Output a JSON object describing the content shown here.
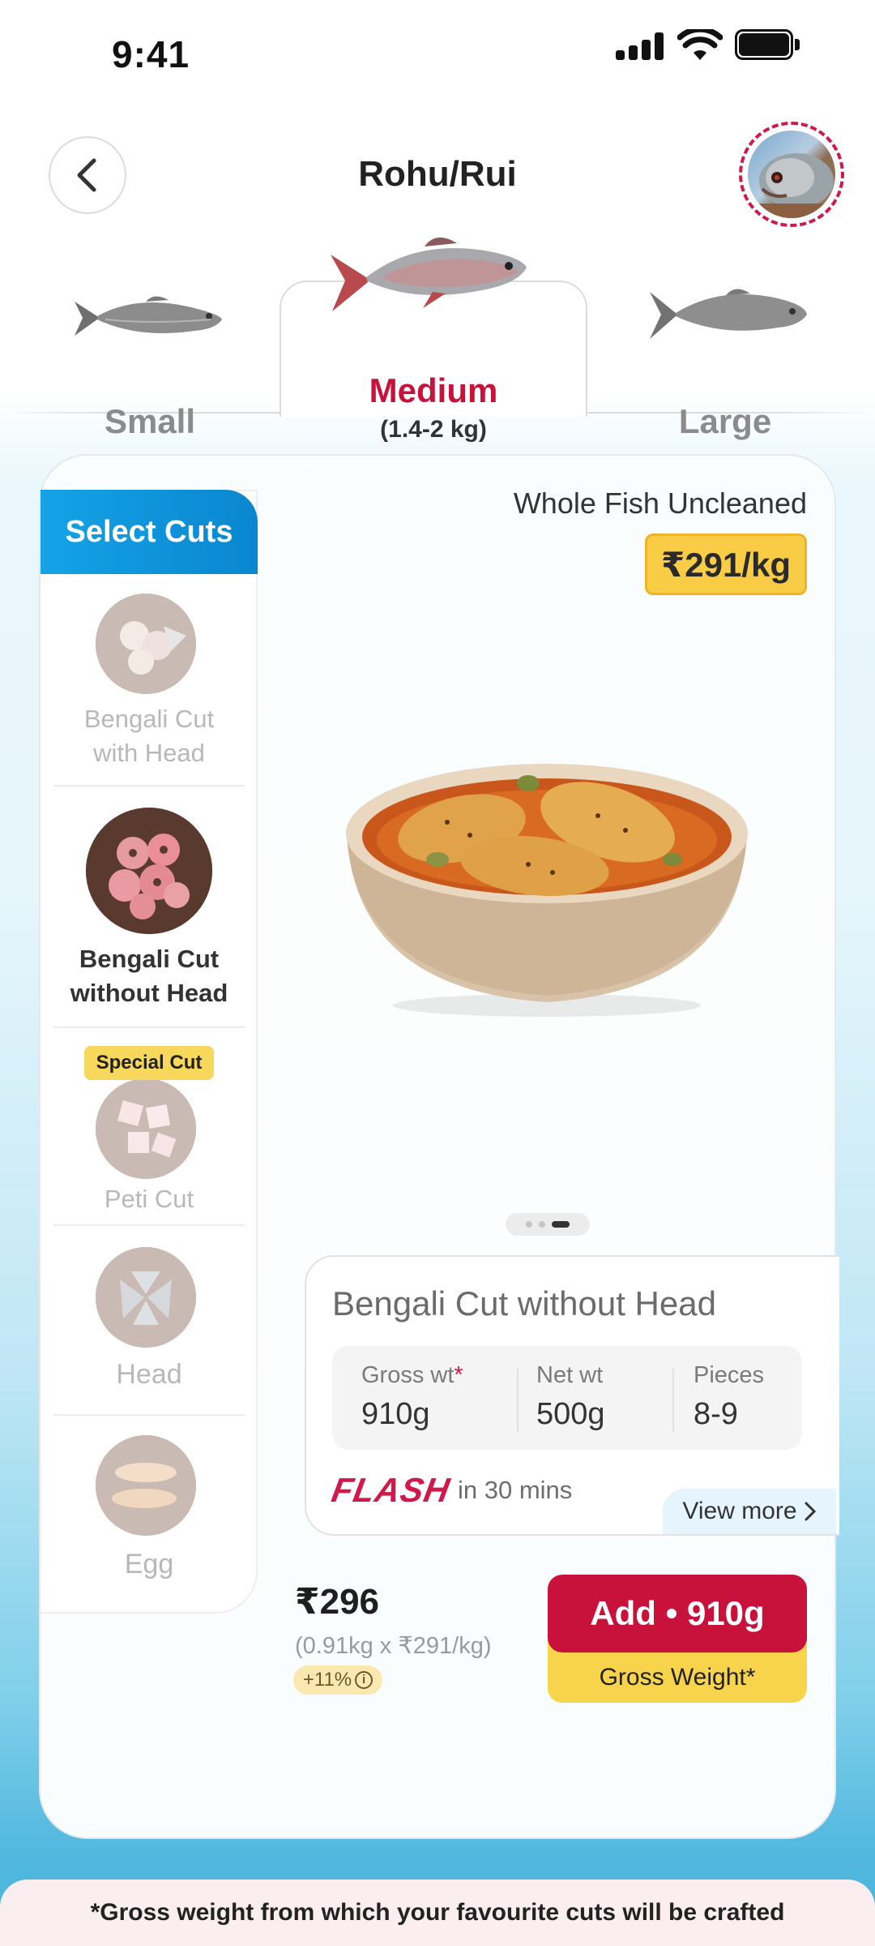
{
  "status_bar": {
    "time": "9:41"
  },
  "header": {
    "title": "Rohu/Rui"
  },
  "size_tabs": [
    {
      "label": "Small",
      "selected": false
    },
    {
      "label": "Medium",
      "sub": "(1.4-2 kg)",
      "selected": true
    },
    {
      "label": "Large",
      "selected": false
    }
  ],
  "cuts": {
    "header": "Select Cuts",
    "items": [
      {
        "label_line1": "Bengali Cut",
        "label_line2": "with Head",
        "selected": false
      },
      {
        "label_line1": "Bengali Cut",
        "label_line2": "without Head",
        "selected": true
      },
      {
        "label_line1": "Peti Cut",
        "badge": "Special Cut",
        "selected": false
      },
      {
        "label_line1": "Head",
        "selected": false
      },
      {
        "label_line1": "Egg",
        "selected": false
      }
    ]
  },
  "product": {
    "type": "Whole Fish Uncleaned",
    "price_per_kg": "₹291/kg",
    "carousel": {
      "count": 3,
      "active_index": 2
    },
    "cut_name": "Bengali Cut without Head",
    "gross_wt_label": "Gross wt",
    "gross_wt_mark": "*",
    "gross_wt": "910g",
    "net_wt_label": "Net wt",
    "net_wt": "500g",
    "pieces_label": "Pieces",
    "pieces": "8-9",
    "delivery_brand": "FLASH",
    "delivery_text": "in 30 mins",
    "view_more": "View more"
  },
  "purchase": {
    "total": "₹296",
    "calc": "(0.91kg x ₹291/kg)",
    "pct": "+11%",
    "add_label": "Add • 910g",
    "add_sub": "Gross Weight*"
  },
  "footer_note": "*Gross weight from which your favourite cuts will be crafted",
  "colors": {
    "brand_red": "#c8123c",
    "accent_blue": "#0a86cf",
    "price_yellow": "#f9cc45"
  }
}
